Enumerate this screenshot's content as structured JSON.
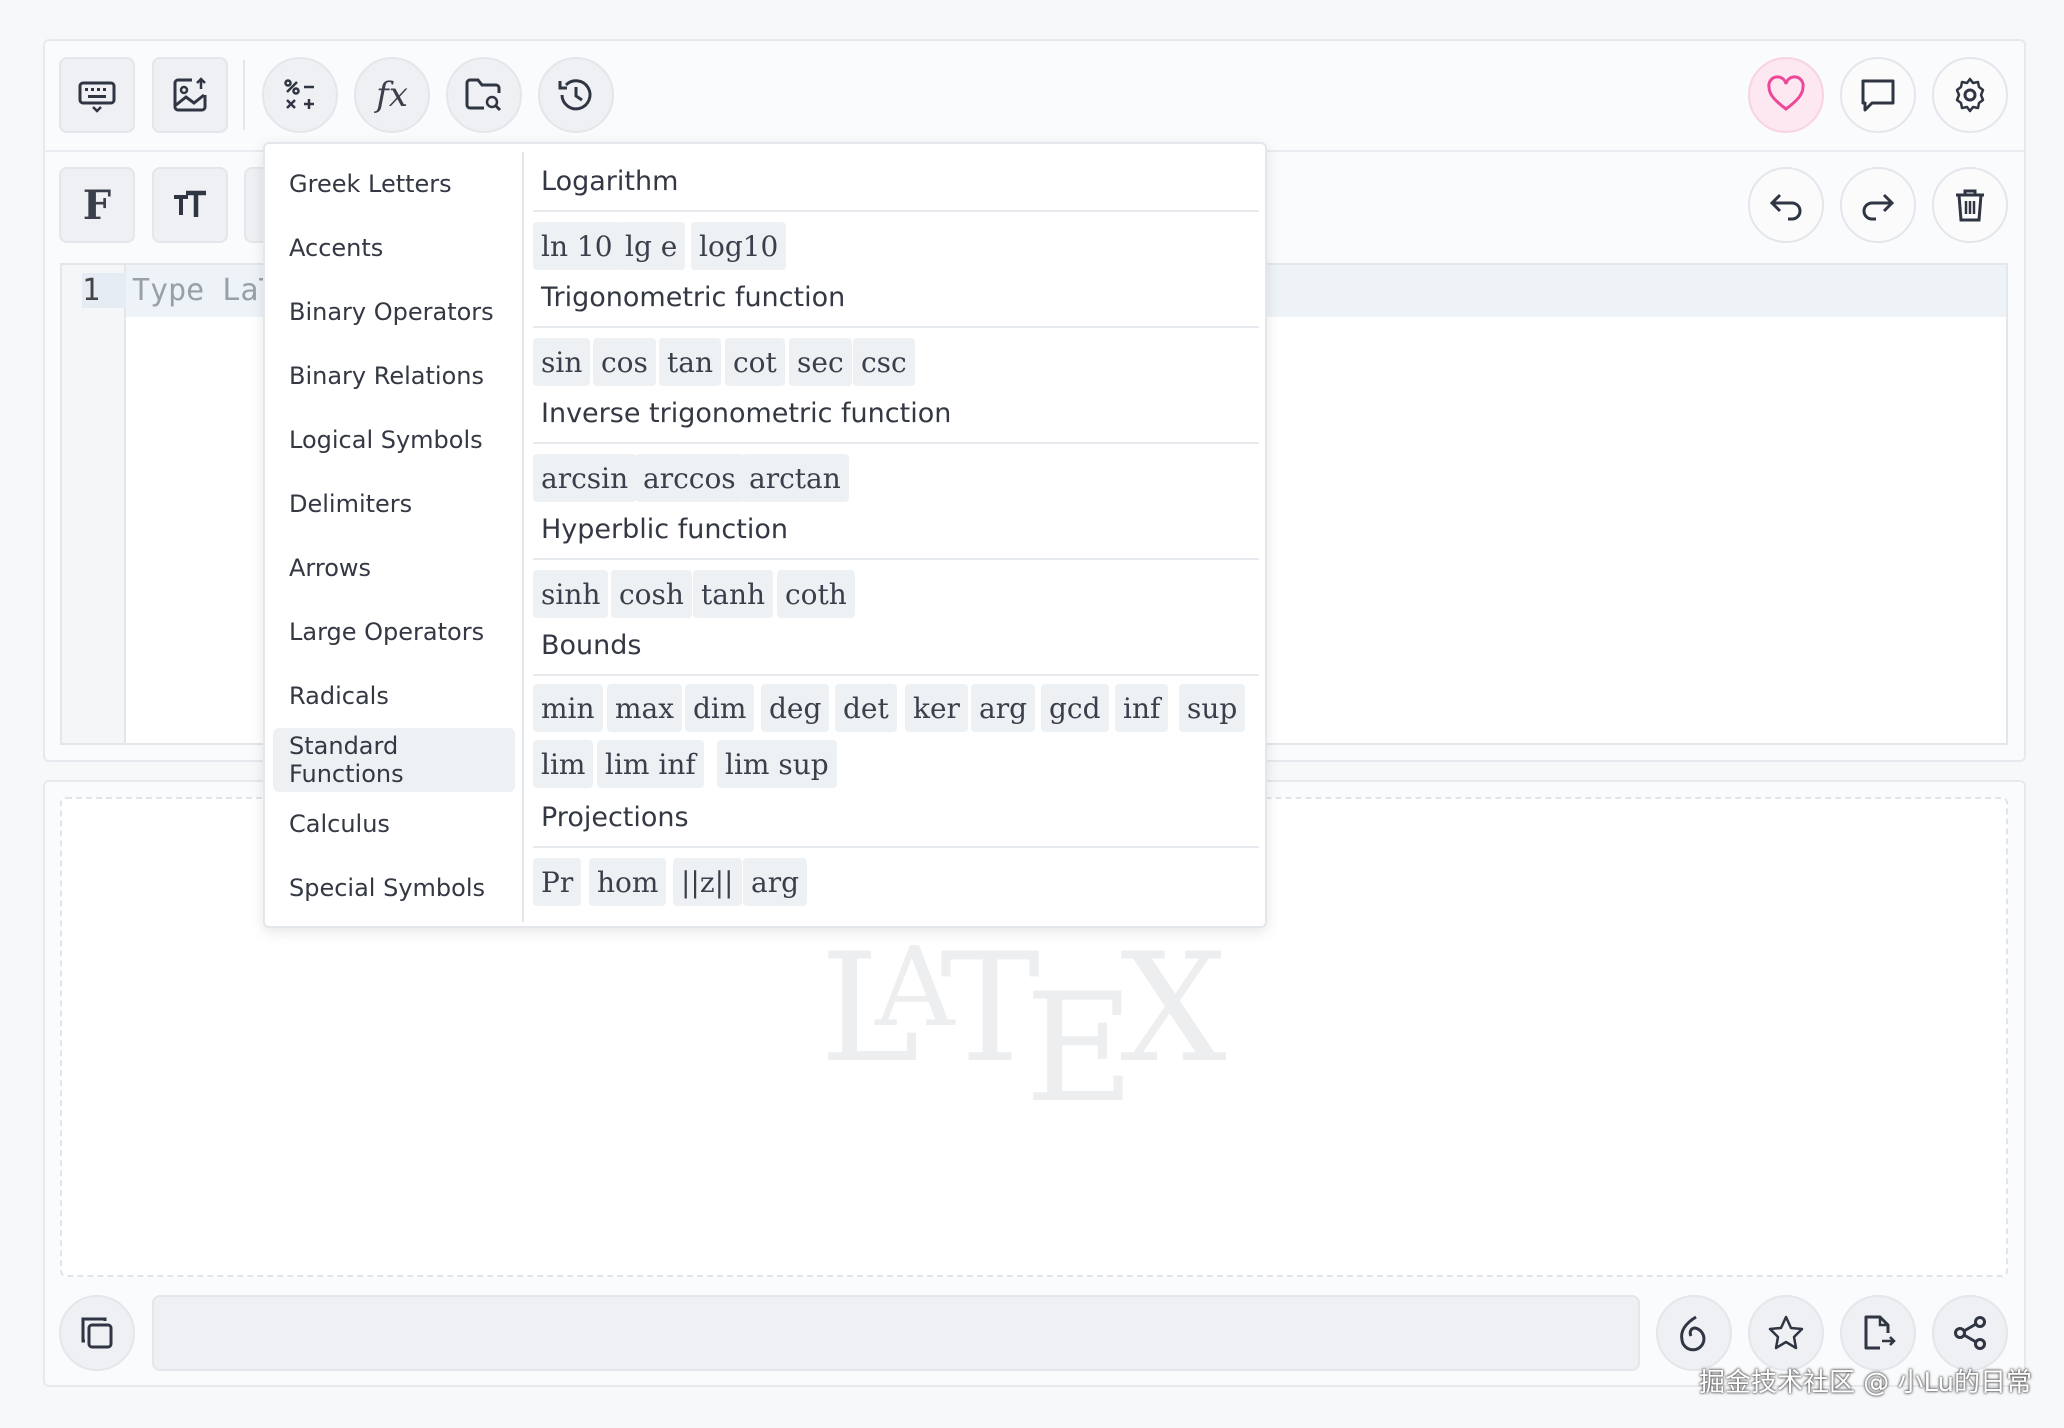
{
  "editor": {
    "line_number": "1",
    "placeholder": "Type LaT"
  },
  "categories": [
    "Greek Letters",
    "Accents",
    "Binary Operators",
    "Binary Relations",
    "Logical Symbols",
    "Delimiters",
    "Arrows",
    "Large Operators",
    "Radicals",
    "Standard Functions",
    "Calculus",
    "Special Symbols"
  ],
  "active_category": "Standard Functions",
  "sections": {
    "logarithm": {
      "title": "Logarithm",
      "items": [
        "ln 10",
        "lg e",
        "log10"
      ]
    },
    "trig": {
      "title": "Trigonometric function",
      "items": [
        "sin",
        "cos",
        "tan",
        "cot",
        "sec",
        "csc"
      ]
    },
    "inverse_trig": {
      "title": "Inverse trigonometric function",
      "items": [
        "arcsin",
        "arccos",
        "arctan"
      ]
    },
    "hyperbolic": {
      "title": "Hyperblic function",
      "items": [
        "sinh",
        "cosh",
        "tanh",
        "coth"
      ]
    },
    "bounds": {
      "title": "Bounds",
      "items": [
        "min",
        "max",
        "dim",
        "deg",
        "det",
        "ker",
        "arg",
        "gcd",
        "inf",
        "sup",
        "lim",
        "lim inf",
        "lim sup"
      ]
    },
    "projections": {
      "title": "Projections",
      "items": [
        "Pr",
        "hom",
        "||z||",
        "arg"
      ]
    }
  },
  "toolbar": {
    "font_label": "F"
  },
  "icons": {
    "keyboard": "keyboard-icon",
    "image_upload": "image-upload-icon",
    "operators": "operators-icon",
    "function": "fx-icon",
    "folder_search": "folder-search-icon",
    "history": "history-icon",
    "heart": "heart-icon",
    "comment": "comment-icon",
    "settings": "gear-icon",
    "undo": "undo-icon",
    "redo": "redo-icon",
    "trash": "trash-icon",
    "copy": "copy-icon",
    "logo_swirl": "swirl-icon",
    "star": "star-icon",
    "export": "file-export-icon",
    "share": "share-icon"
  },
  "colors": {
    "heart": "#ec4899",
    "panel_bg": "#fafbfc",
    "chip_bg": "#eef1f4"
  },
  "watermark": "掘金技术社区 @ 小Lu的日常"
}
